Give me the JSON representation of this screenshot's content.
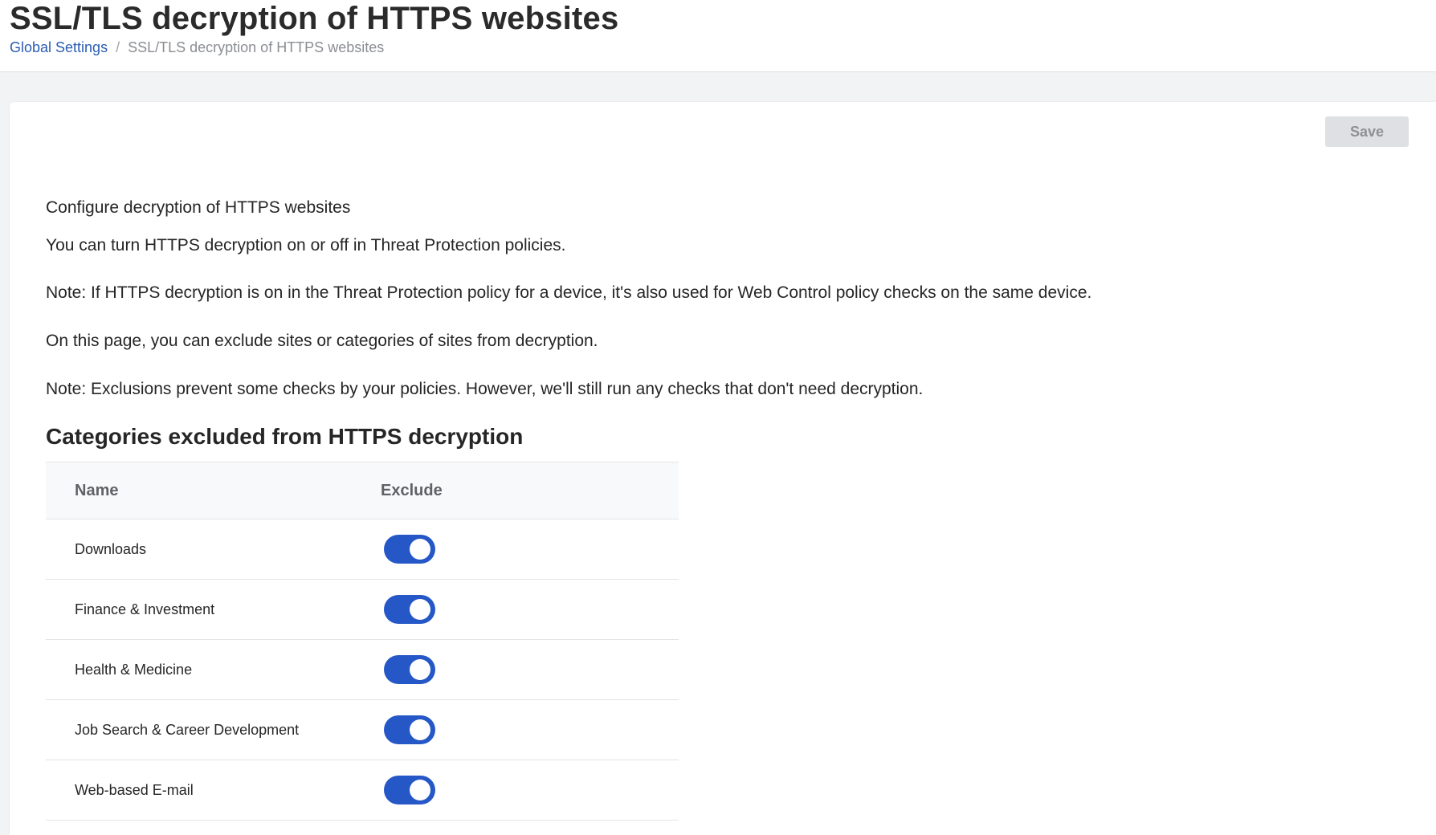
{
  "header": {
    "title": "SSL/TLS decryption of HTTPS websites",
    "breadcrumb": {
      "parent": "Global Settings",
      "separator": "/",
      "current": "SSL/TLS decryption of HTTPS websites"
    }
  },
  "toolbar": {
    "save_label": "Save"
  },
  "intro": {
    "title": "Configure decryption of HTTPS websites",
    "paragraphs": [
      "You can turn HTTPS decryption on or off in Threat Protection policies.",
      "Note: If HTTPS decryption is on in the Threat Protection policy for a device, it's also used for Web Control policy checks on the same device.",
      "On this page, you can exclude sites or categories of sites from decryption.",
      "Note: Exclusions prevent some checks by your policies. However, we'll still run any checks that don't need decryption."
    ]
  },
  "categories": {
    "heading": "Categories excluded from HTTPS decryption",
    "columns": {
      "name": "Name",
      "exclude": "Exclude"
    },
    "rows": [
      {
        "name": "Downloads",
        "excluded": true
      },
      {
        "name": "Finance & Investment",
        "excluded": true
      },
      {
        "name": "Health & Medicine",
        "excluded": true
      },
      {
        "name": "Job Search & Career Development",
        "excluded": true
      },
      {
        "name": "Web-based E-mail",
        "excluded": true
      }
    ]
  },
  "colors": {
    "accent": "#2557c7",
    "link": "#2a5db0",
    "disabled_button_bg": "#dfe0e3"
  }
}
